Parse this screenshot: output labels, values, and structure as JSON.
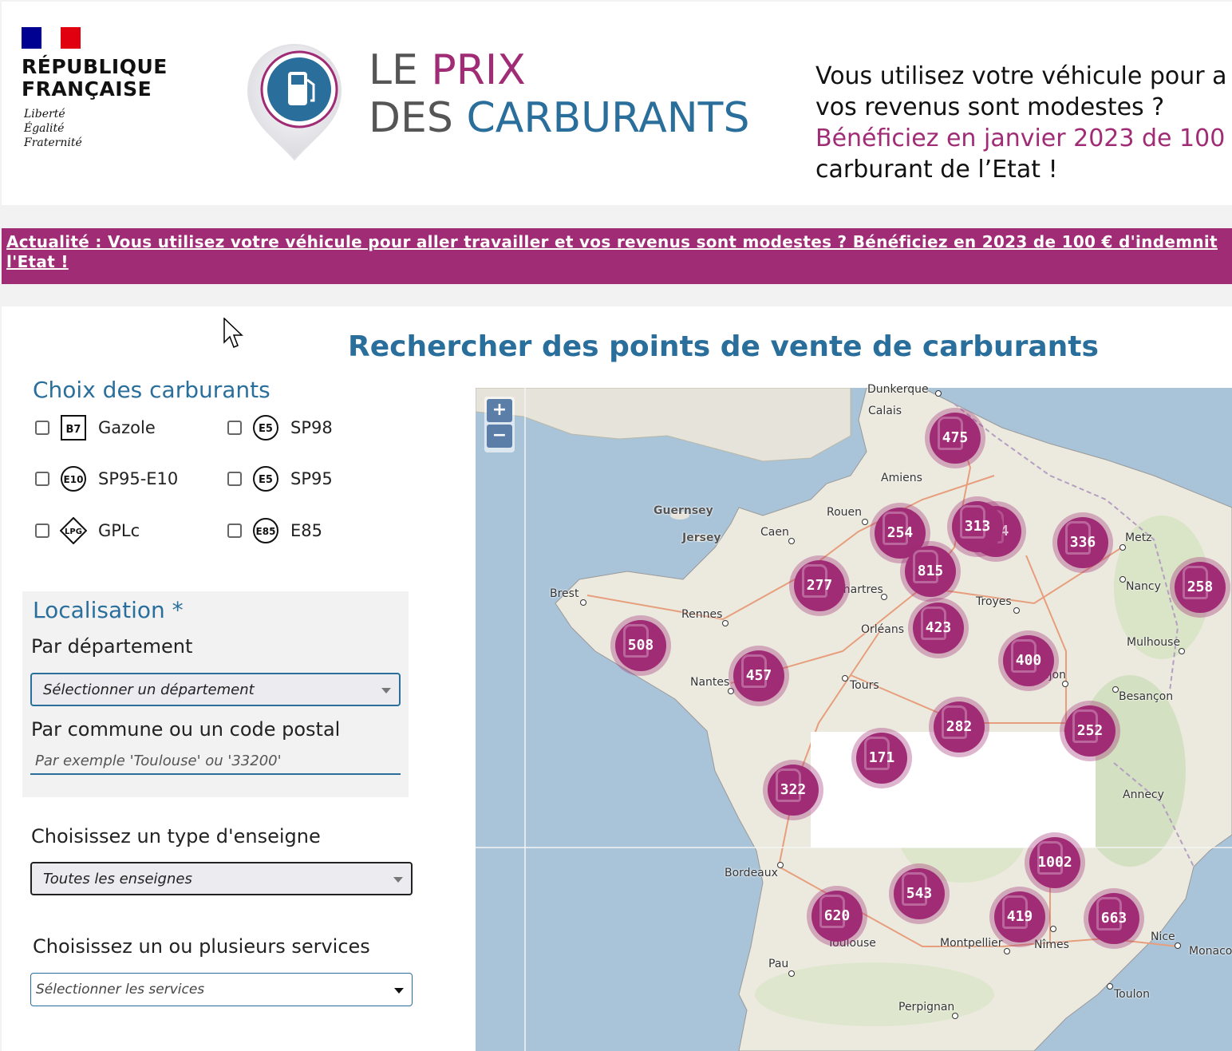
{
  "header": {
    "rf_title_line1": "RÉPUBLIQUE",
    "rf_title_line2": "FRANÇAISE",
    "motto_1": "Liberté",
    "motto_2": "Égalité",
    "motto_3": "Fraternité",
    "logo_le": "LE",
    "logo_prix": "PRIX",
    "logo_des": "DES",
    "logo_carburants": "CARBURANTS",
    "promo_line1": "Vous utilisez votre véhicule pour a",
    "promo_line2": "vos revenus sont modestes ?",
    "promo_line3": "Bénéficiez en janvier 2023 de 100 ",
    "promo_line4": "carburant de l’Etat !",
    "colors": {
      "flag_blue": "#000091",
      "flag_red": "#e1000f",
      "brand_pink": "#a02c76",
      "brand_blue": "#2a6f9c"
    }
  },
  "banner": {
    "line1": "Actualité : Vous utilisez votre véhicule pour aller travailler et vos revenus sont modestes ? Bénéficiez en 2023 de 100 € d'indemnit",
    "line2": "l'Etat !"
  },
  "main": {
    "title": "Rechercher des points de vente de carburants"
  },
  "fuels": {
    "title": "Choix des carburants",
    "items": [
      {
        "icon": "B7",
        "label": "Gazole"
      },
      {
        "icon": "E5",
        "label": "SP98"
      },
      {
        "icon": "E10",
        "label": "SP95-E10"
      },
      {
        "icon": "E5",
        "label": "SP95"
      },
      {
        "icon": "LPG",
        "label": "GPLc"
      },
      {
        "icon": "E85",
        "label": "E85"
      }
    ]
  },
  "location": {
    "title": "Localisation *",
    "dept_label": "Par département",
    "dept_select": "Sélectionner un département",
    "commune_label": "Par commune ou un code postal",
    "commune_placeholder": "Par exemple 'Toulouse' ou '33200'"
  },
  "enseigne": {
    "label": "Choisissez un type d'enseigne",
    "value": "Toutes les enseignes"
  },
  "services": {
    "label": "Choisissez un ou plusieurs services",
    "value": "Sélectionner les services"
  },
  "map": {
    "zoom_in": "+",
    "zoom_out": "−",
    "clusters": [
      "475",
      "254",
      "313",
      "254",
      "336",
      "815",
      "277",
      "258",
      "423",
      "508",
      "457",
      "400",
      "282",
      "252",
      "171",
      "322",
      "1002",
      "543",
      "620",
      "419",
      "663"
    ],
    "cities": [
      "Dunkerque",
      "Calais",
      "Amiens",
      "Guernsey",
      "Jersey",
      "Rouen",
      "Caen",
      "Metz",
      "Brest",
      "Chartres",
      "Nancy",
      "Rennes",
      "Troyes",
      "Orléans",
      "Mulhouse",
      "Nantes",
      "Tours",
      "Dijon",
      "Besançon",
      "Annecy",
      "Bordeaux",
      "Toulouse",
      "Montpellier",
      "Nîmes",
      "Nice",
      "Monaco",
      "Pau",
      "Toulon",
      "Perpignan"
    ]
  }
}
